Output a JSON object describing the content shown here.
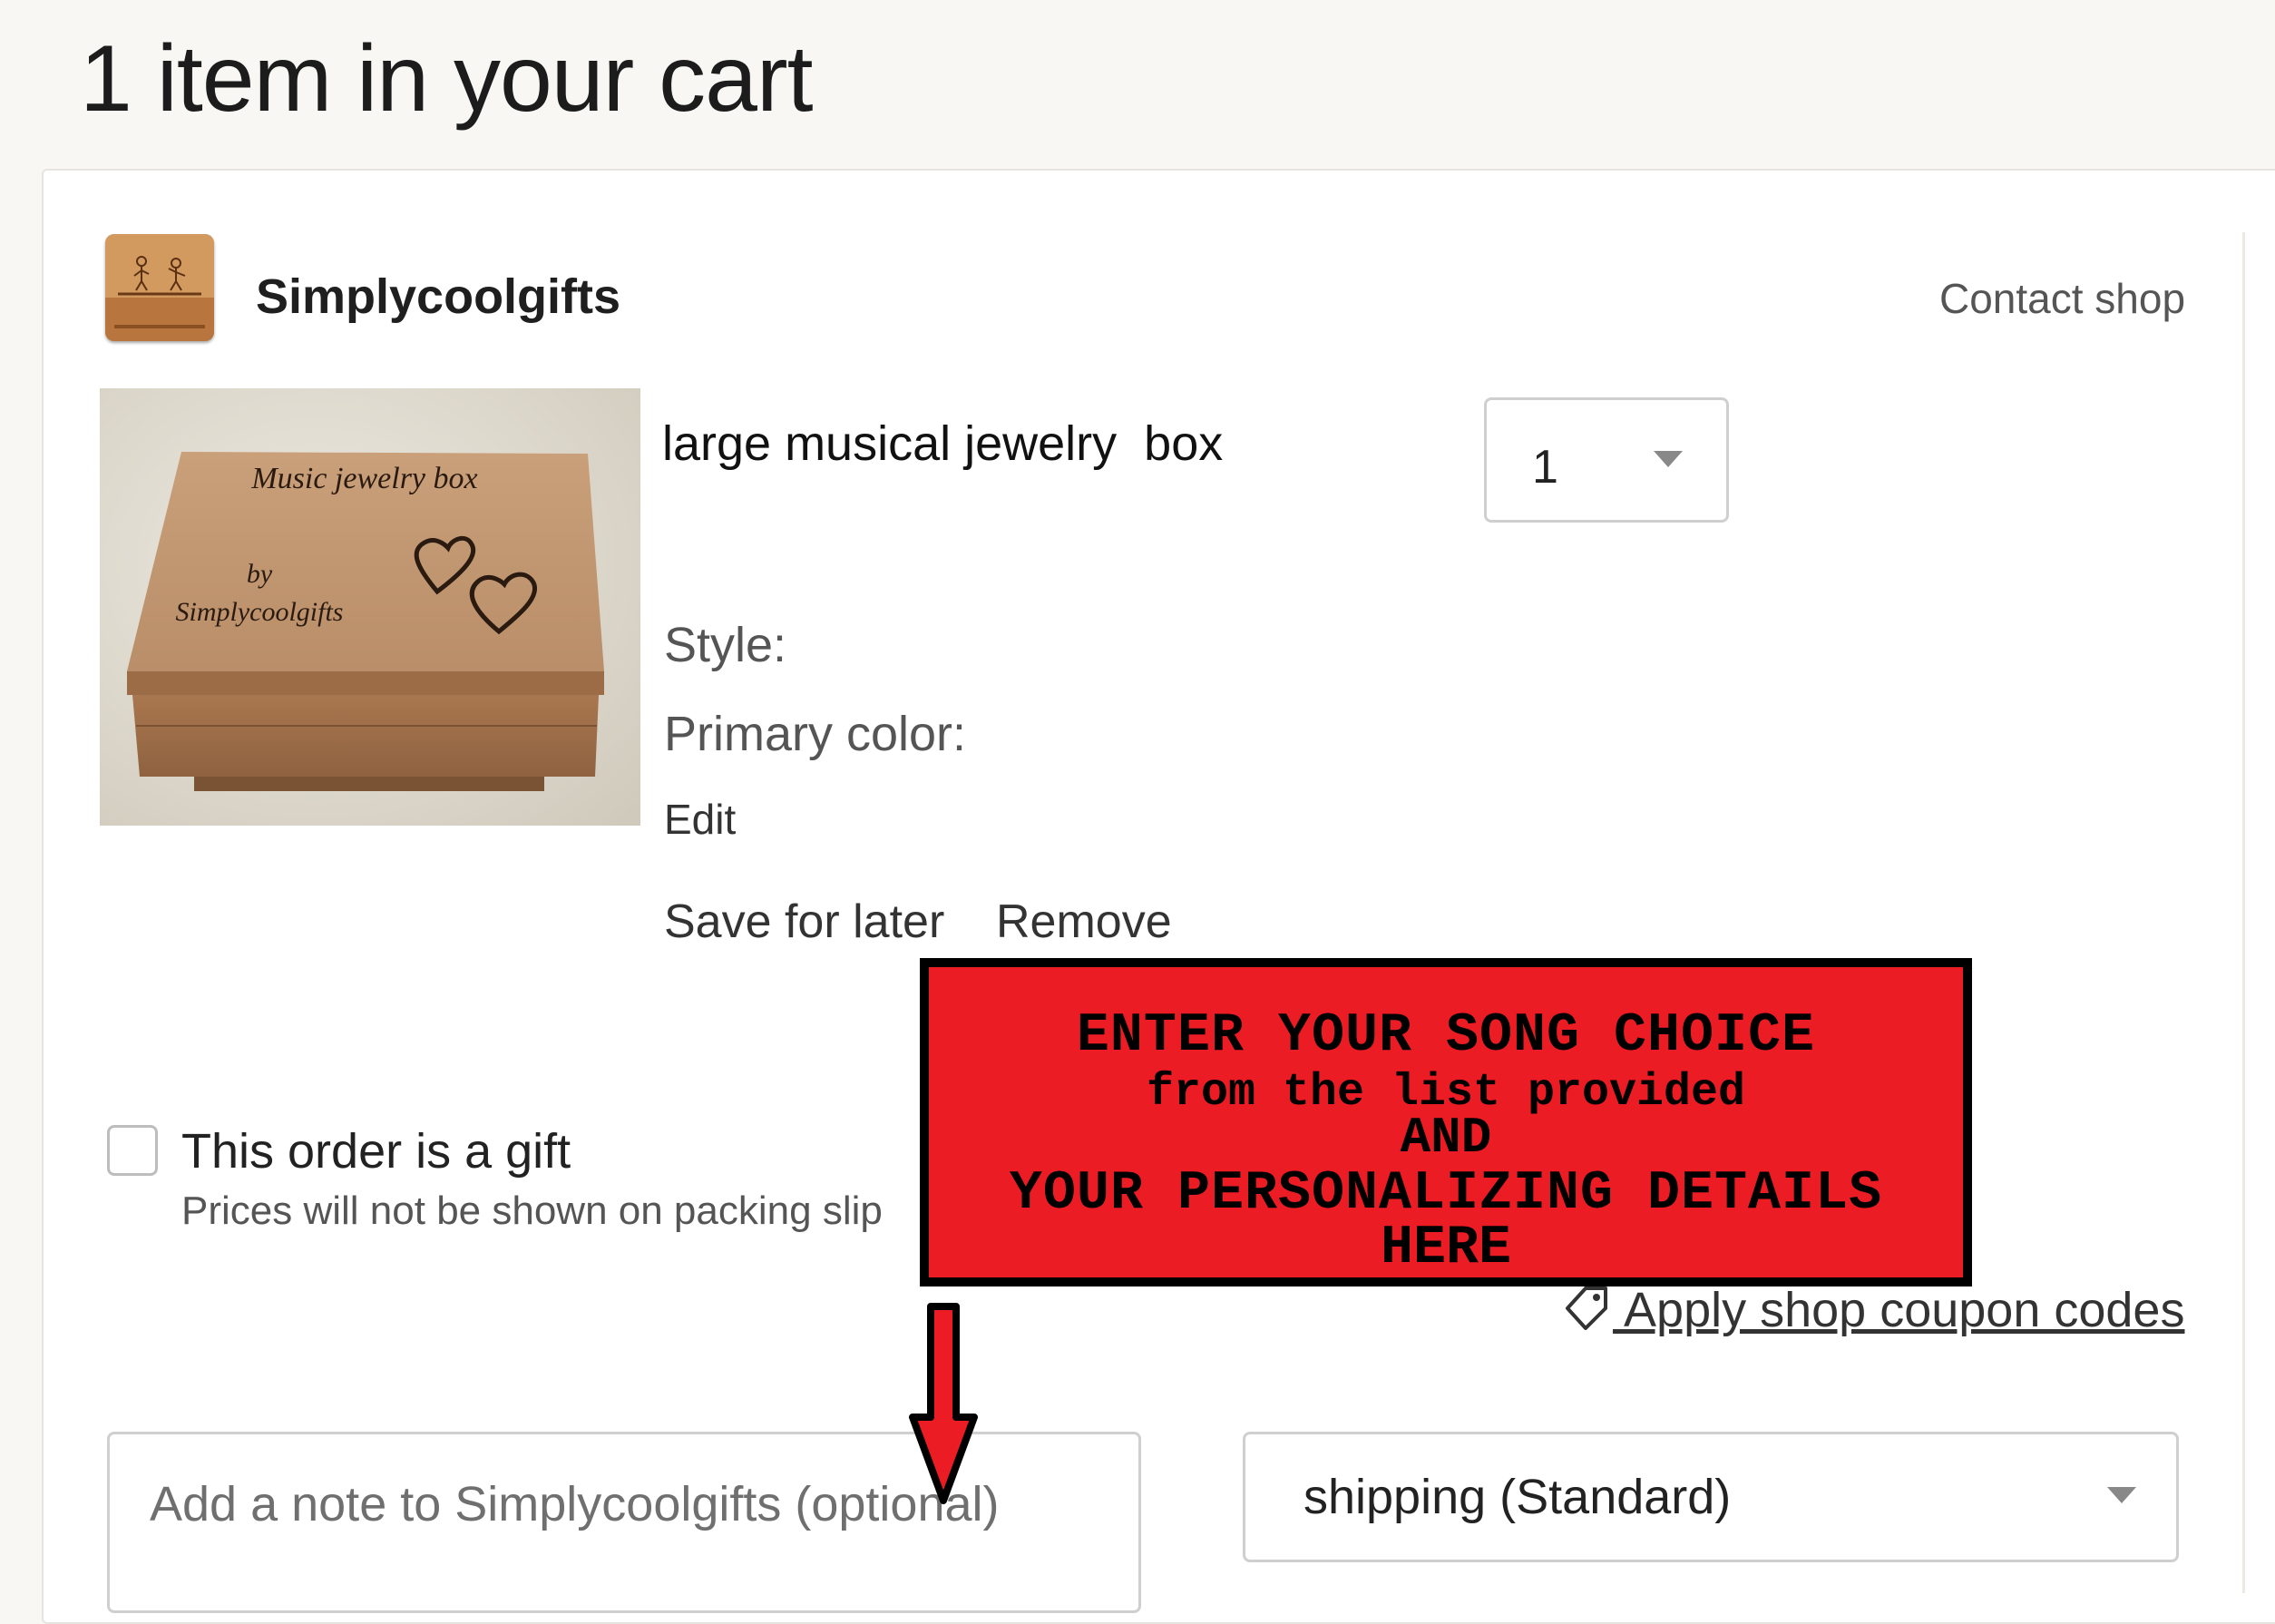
{
  "page": {
    "title": "1 item in your cart"
  },
  "shop": {
    "name": "Simplycoolgifts",
    "contact_label": "Contact shop"
  },
  "product": {
    "title": "large musical jewelry  box",
    "thumbnail_text": {
      "line1": "Music jewelry box",
      "line2": "by",
      "line3": "Simplycoolgifts"
    },
    "quantity": "1",
    "style_label": "Style:",
    "primary_color_label": "Primary color:",
    "edit_label": "Edit",
    "save_for_later_label": "Save for later",
    "remove_label": "Remove"
  },
  "gift": {
    "label": "This order is a gift",
    "sublabel": "Prices will not be shown on packing slip",
    "checked": false
  },
  "banner": {
    "line1": "ENTER YOUR SONG CHOICE",
    "line2": "from the list provided",
    "line3": "AND",
    "line4": "YOUR PERSONALIZING DETAILS",
    "line5": "HERE",
    "background_color": "#ec1c24"
  },
  "coupon": {
    "label": " Apply shop coupon codes",
    "icon": "tag-icon"
  },
  "note": {
    "placeholder": "Add a note to Simplycoolgifts (optional)",
    "value": ""
  },
  "shipping": {
    "selected": "shipping (Standard)"
  }
}
